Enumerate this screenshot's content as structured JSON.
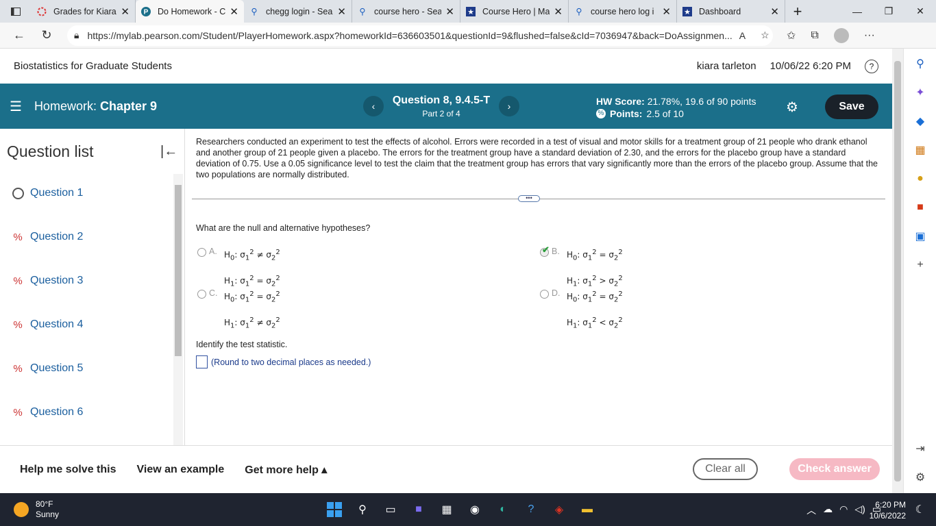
{
  "browser": {
    "tabs": [
      {
        "title": "Grades for Kiara T",
        "icon": "grades-icon",
        "active": false
      },
      {
        "title": "Do Homework - C",
        "icon": "pearson-icon",
        "active": true
      },
      {
        "title": "chegg login - Sea",
        "icon": "search-icon",
        "active": false
      },
      {
        "title": "course hero - Sea",
        "icon": "search-icon",
        "active": false
      },
      {
        "title": "Course Hero | Ma",
        "icon": "star-icon",
        "active": false
      },
      {
        "title": "course hero log i",
        "icon": "search-icon",
        "active": false
      },
      {
        "title": "Dashboard",
        "icon": "star-icon",
        "active": false
      }
    ],
    "url": "https://mylab.pearson.com/Student/PlayerHomework.aspx?homeworkId=636603501&questionId=9&flushed=false&cId=7036947&back=DoAssignmen..."
  },
  "course": {
    "title": "Biostatistics for Graduate Students",
    "user": "kiara tarleton",
    "datetime": "10/06/22 6:20 PM"
  },
  "header": {
    "homework_prefix": "Homework:",
    "homework_name": "Chapter 9",
    "question_title": "Question 8, 9.4.5-T",
    "part": "Part 2 of 4",
    "hw_score_label": "HW Score:",
    "hw_score_value": "21.78%, 19.6 of 90 points",
    "points_label": "Points:",
    "points_value": "2.5 of 10",
    "save_label": "Save"
  },
  "question_list": {
    "heading": "Question list",
    "items": [
      {
        "label": "Question 1",
        "status": "not-started"
      },
      {
        "label": "Question 2",
        "status": "partial"
      },
      {
        "label": "Question 3",
        "status": "partial"
      },
      {
        "label": "Question 4",
        "status": "partial"
      },
      {
        "label": "Question 5",
        "status": "partial"
      },
      {
        "label": "Question 6",
        "status": "partial"
      }
    ]
  },
  "question": {
    "problem": "Researchers conducted an experiment to test the effects of alcohol. Errors were recorded in a test of visual and motor skills for a treatment group of 21 people who drank ethanol and another group of 21 people given a placebo. The errors for the treatment group have a standard deviation of 2.30, and the errors for the placebo group have a standard deviation of 0.75. Use a 0.05 significance level to test the claim that the treatment group has errors that vary significantly more than the errors of the placebo group. Assume that the two populations are normally distributed.",
    "prompt": "What are the null and alternative hypotheses?",
    "options": [
      {
        "letter": "A.",
        "h0": "≠",
        "h1": "=",
        "selected": false
      },
      {
        "letter": "B.",
        "h0": "=",
        "h1": ">",
        "selected": true
      },
      {
        "letter": "C.",
        "h0": "=",
        "h1": "≠",
        "selected": false
      },
      {
        "letter": "D.",
        "h0": "=",
        "h1": "<",
        "selected": false
      }
    ],
    "identify": "Identify the test statistic.",
    "round_note": "(Round to two decimal places as needed.)"
  },
  "footer": {
    "help_solve": "Help me solve this",
    "view_example": "View an example",
    "get_more_help": "Get more help ▴",
    "clear_all": "Clear all",
    "check_answer": "Check answer"
  },
  "taskbar": {
    "temp": "80°F",
    "condition": "Sunny",
    "time": "6:20 PM",
    "date": "10/6/2022"
  }
}
